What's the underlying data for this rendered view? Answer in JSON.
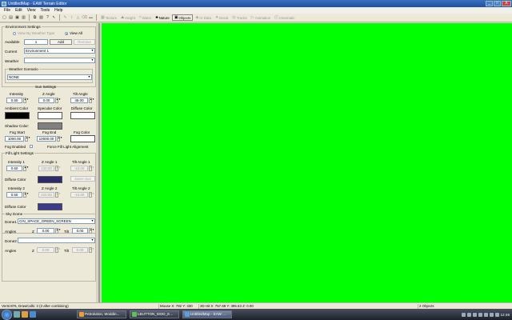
{
  "window": {
    "title": "UntitledMap - EAW Terrain Editor",
    "controls": [
      "_",
      "□",
      "X"
    ]
  },
  "menu": [
    "File",
    "Edit",
    "View",
    "Tools",
    "Help"
  ],
  "toolbar": {
    "file_icons": [
      "new-icon",
      "open-icon",
      "save-icon",
      "save-all-icon",
      "copy-icon",
      "paste-icon",
      "help-icon",
      "pointer-help-icon"
    ],
    "tool_icons": [
      "pencil-icon",
      "brush-icon",
      "fill-icon",
      "eraser-icon",
      "line-icon"
    ],
    "modes": [
      {
        "label": "Texture",
        "glyph": "▦"
      },
      {
        "label": "Height",
        "glyph": "⛰"
      },
      {
        "label": "Water",
        "glyph": "≈"
      },
      {
        "label": "Nature",
        "glyph": "♣"
      },
      {
        "label": "Objects",
        "glyph": "▣"
      },
      {
        "label": "AI Data",
        "glyph": "◈"
      },
      {
        "label": "Decal",
        "glyph": "✦"
      },
      {
        "label": "Tracks",
        "glyph": "◎"
      },
      {
        "label": "Animation",
        "glyph": "▷"
      },
      {
        "label": "Cinematic",
        "glyph": "◰"
      }
    ]
  },
  "environment": {
    "group_label": "Environment Settings",
    "radio_weather_type": "View By Weather Type",
    "radio_view_all": "View All",
    "available_label": "Available",
    "available_value": "1",
    "add_label": "Add",
    "remove_label": "Remove",
    "current_label": "Current",
    "current_value": "Environment 1",
    "weather_label": "Weather",
    "weather_value": "",
    "weather_scenario_label": "Weather Scenario",
    "weather_scenario_value": "NONE"
  },
  "sun": {
    "section_label": "Sun Settings",
    "intensity_label": "Intensity",
    "intensity_value": "0.50",
    "z_angle_label": "Z Angle",
    "z_angle_value": "0.00",
    "tilt_angle_label": "Tilt Angle",
    "tilt_angle_value": "45.00",
    "ambient_label": "Ambient Color",
    "specular_label": "Specular Color",
    "diffuse_label": "Diffuse Color",
    "shadow_label": "Shadow Color:",
    "ambient_color": "#000000",
    "specular_color": "#ffffff",
    "diffuse_color": "#ffffff",
    "shadow_color": "#808080"
  },
  "fog": {
    "start_label": "Fog Start",
    "start_value": "1000.00",
    "end_label": "Fog End",
    "end_value": "10000.00",
    "color_label": "Fog Color",
    "color_value": "#ffffff",
    "enabled_label": "Fog Enabled",
    "force_fill_label": "Force Fill Light Alignment"
  },
  "fill_light": {
    "group_label": "Fill Light Settings",
    "intensity1_label": "Intensity 1",
    "intensity1_value": "0.50",
    "z_angle1_label": "Z Angle 1",
    "z_angle1_value": "120.00",
    "tilt_angle1_label": "Tilt Angle 1",
    "tilt_angle1_value": "-10.00",
    "diffuse1_label": "Diffuse Color",
    "diffuse1_color": "#2c2c6c",
    "same_sun_label": "Same Sun",
    "intensity2_label": "Intensity 2",
    "intensity2_value": "0.50",
    "z_angle2_label": "Z Angle 2",
    "z_angle2_value": "210.00",
    "tilt_angle2_label": "Tilt Angle 2",
    "tilt_angle2_value": "-10.00",
    "diffuse2_label": "Diffuse Color",
    "diffuse2_color": "#3c3c8c"
  },
  "sky_dome": {
    "group_label": "Sky Dome",
    "dome1_label": "Dome1",
    "dome1_value": "CIN_SPACE_GREEN_SCREEN",
    "angles1_label": "Angles",
    "angles1_z_label": "Z",
    "angles1_z_value": "0.00",
    "tilt1_label": "Tilt",
    "tilt1_value": "0.00",
    "dome2_label": "Dome2",
    "dome2_value": "",
    "angles2_label": "Angles",
    "angles2_z_label": "Z",
    "angles2_z_value": "0.00",
    "tilt2_label": "Tilt",
    "tilt2_value": "0.00"
  },
  "viewport": {
    "background": "#00ff00"
  },
  "status": {
    "verts": "Verts:876, DrawCalls: 3 (3 after combining)",
    "mouse": "Mouse X: 782 Y: 330",
    "hit": "3D Hit X: 757.69 Y: 395.53 Z: 0.00",
    "objects": "2 Objects"
  },
  "taskbar": {
    "tasks": [
      "Petrolution, Moddin...",
      "LBUTTON_MOD_E...",
      "UntitledMap - EAW ..."
    ],
    "clock": "12:46"
  }
}
